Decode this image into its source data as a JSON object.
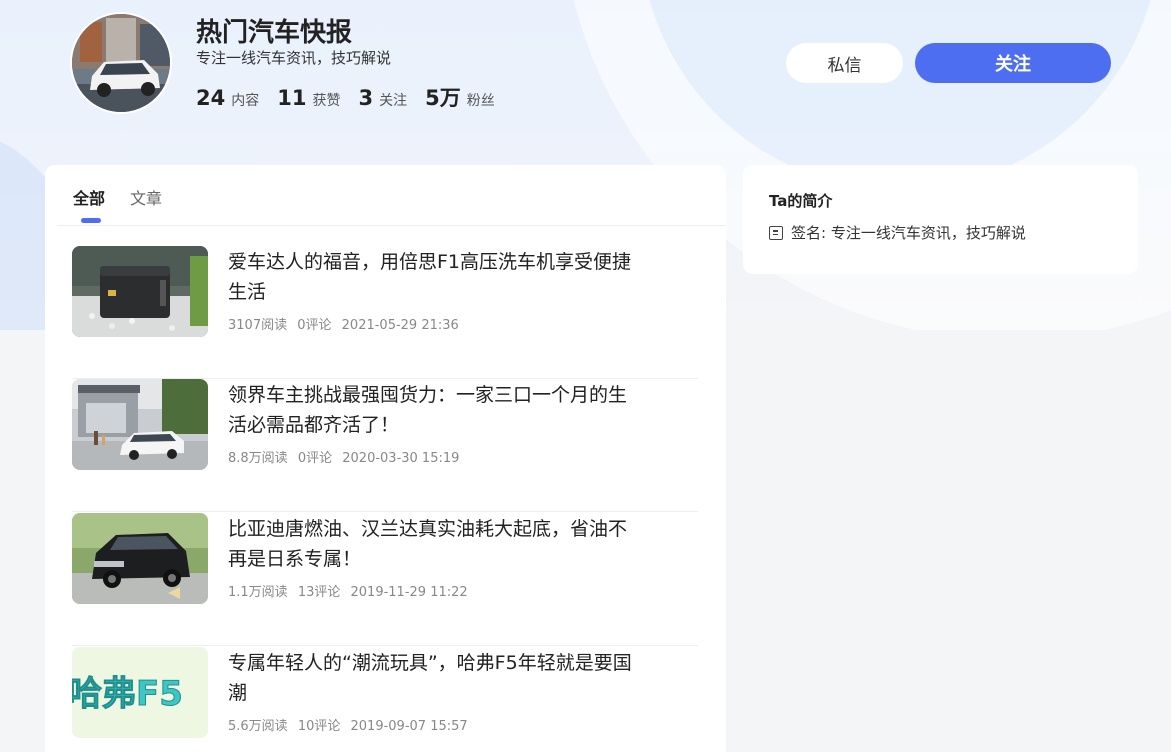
{
  "profile": {
    "name": "热门汽车快报",
    "bio": "专注一线汽车资讯，技巧解说",
    "stats": [
      {
        "num": "24",
        "label": "内容"
      },
      {
        "num": "11",
        "label": "获赞"
      },
      {
        "num": "3",
        "label": "关注"
      },
      {
        "num": "5万",
        "label": "粉丝"
      }
    ],
    "message_label": "私信",
    "follow_label": "关注"
  },
  "tabs": [
    {
      "label": "全部",
      "active": true
    },
    {
      "label": "文章",
      "active": false
    }
  ],
  "articles": [
    {
      "title": "爱车达人的福音，用倍思F1高压洗车机享受便捷生活",
      "reads": "3107阅读",
      "comments": "0评论",
      "time": "2021-05-29 21:36",
      "thumb": "pressure-washer-photo"
    },
    {
      "title": "领界车主挑战最强囤货力：一家三口一个月的生活必需品都齐活了！",
      "reads": "8.8万阅读",
      "comments": "0评论",
      "time": "2020-03-30 15:19",
      "thumb": "white-suv-house-photo"
    },
    {
      "title": "比亚迪唐燃油、汉兰达真实油耗大起底，省油不再是日系专属！",
      "reads": "1.1万阅读",
      "comments": "13评论",
      "time": "2019-11-29 11:22",
      "thumb": "black-suv-parking-photo"
    },
    {
      "title": "专属年轻人的“潮流玩具”，哈弗F5年轻就是要国潮",
      "reads": "5.6万阅读",
      "comments": "10评论",
      "time": "2019-09-07 15:57",
      "thumb": "haval-f5-text-graphic",
      "thumb_text": "哈弗F5"
    }
  ],
  "sidebar": {
    "title": "Ta的简介",
    "signature": "签名: 专注一线汽车资讯，技巧解说"
  },
  "colors": {
    "accent": "#4e6ef2",
    "page_bg": "#f4f5f7",
    "card_bg": "#ffffff"
  }
}
